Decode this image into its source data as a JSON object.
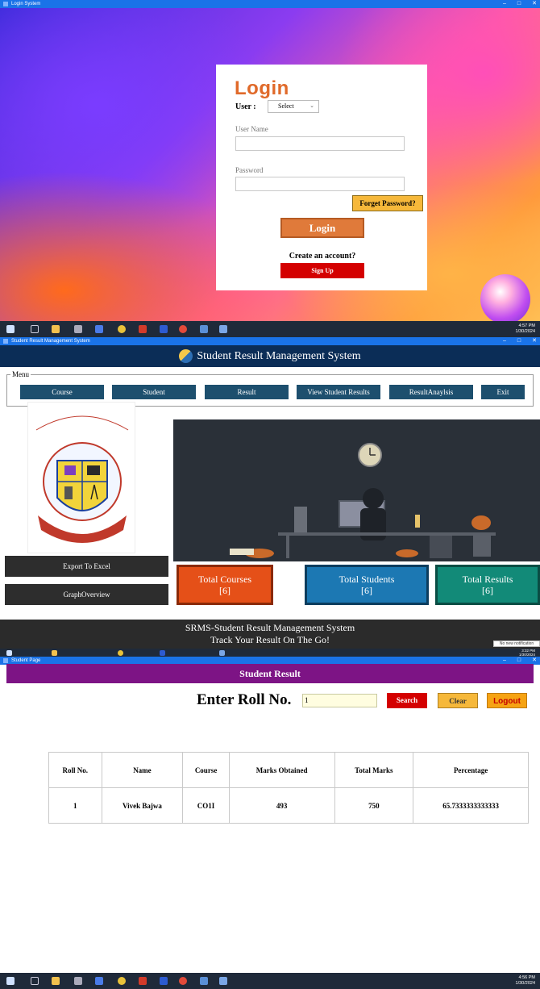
{
  "login_screen": {
    "window_title": "Login System",
    "title": "Login",
    "user_label": "User :",
    "user_select": "Select",
    "username_label": "User Name",
    "password_label": "Password",
    "forget_button": "Forget Password?",
    "login_button": "Login",
    "create_account_text": "Create an account?",
    "signup_button": "Sign Up",
    "clock_time": "4:57 PM",
    "clock_date": "1/30/2024"
  },
  "dashboard_screen": {
    "window_title": "Student Result Management System",
    "header_title": "Student Result Management System",
    "menu_legend": "Menu",
    "menu": [
      "Course",
      "Student",
      "Result",
      "View Student Results",
      "ResultAnaylsis",
      "Exit"
    ],
    "side_buttons": [
      "Export To Excel",
      "GraphOverview"
    ],
    "stats": [
      {
        "label": "Total Courses",
        "value": "[6]"
      },
      {
        "label": "Total Students",
        "value": "[6]"
      },
      {
        "label": "Total Results",
        "value": "[6]"
      }
    ],
    "footer_line1": "SRMS-Student Result Management System",
    "footer_line2": "Track Your Result On The Go!",
    "notification": "No new notification",
    "clock_time": "3:32 PM",
    "clock_date": "1/30/2024",
    "logo": {
      "top_text": "MATOSHRI EDUCATION SOCIETY'S",
      "arc_text": "MATOSHRI AASARABAI POLYTECHNIC",
      "location": "EKLAHARE, Dist. NASIK",
      "banner": "Enriching Knowledge"
    }
  },
  "result_screen": {
    "window_title": "Student Page",
    "header_title": "Student Result",
    "roll_label": "Enter Roll No.",
    "roll_value": "1",
    "search_button": "Search",
    "clear_button": "Clear",
    "logout_button": "Logout",
    "table": {
      "headers": [
        "Roll No.",
        "Name",
        "Course",
        "Marks Obtained",
        "Total Marks",
        "Percentage"
      ],
      "rows": [
        [
          "1",
          "Vivek Bajwa",
          "CO1I",
          "493",
          "750",
          "65.7333333333333"
        ]
      ]
    },
    "clock_time": "4:56 PM",
    "clock_date": "1/30/2024"
  }
}
